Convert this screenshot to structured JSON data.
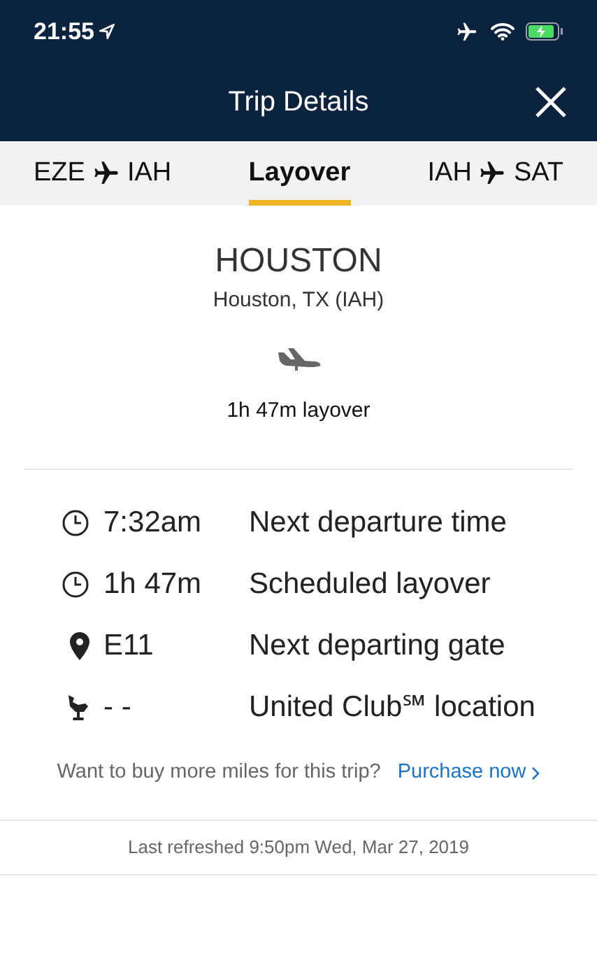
{
  "status_bar": {
    "time": "21:55"
  },
  "header": {
    "title": "Trip Details"
  },
  "tabs": [
    {
      "kind": "route",
      "from": "EZE",
      "to": "IAH",
      "selected": false
    },
    {
      "kind": "text",
      "label": "Layover",
      "selected": true
    },
    {
      "kind": "route",
      "from": "IAH",
      "to": "SAT",
      "selected": false
    }
  ],
  "layover": {
    "city": "HOUSTON",
    "airport": "Houston, TX (IAH)",
    "duration": "1h 47m layover"
  },
  "details": [
    {
      "kind": "clock",
      "value": "7:32am",
      "label": "Next departure time"
    },
    {
      "kind": "clock",
      "value": "1h 47m",
      "label": "Scheduled layover"
    },
    {
      "kind": "pin",
      "value": "E11",
      "label": "Next departing gate"
    },
    {
      "kind": "lounge",
      "value": "- -",
      "label": "United Club℠ location"
    }
  ],
  "purchase": {
    "prompt": "Want to buy more miles for this trip?",
    "link": "Purchase now"
  },
  "footer": {
    "refreshed": "Last refreshed 9:50pm Wed, Mar 27, 2019"
  }
}
